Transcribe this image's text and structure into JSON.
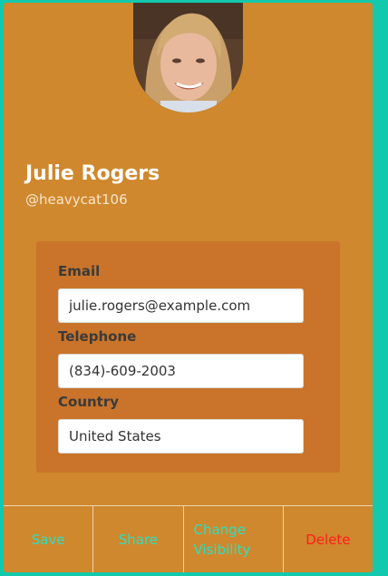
{
  "profile": {
    "name": "Julie Rogers",
    "handle": "@heavycat106"
  },
  "fields": {
    "email": {
      "label": "Email",
      "value": "julie.rogers@example.com"
    },
    "telephone": {
      "label": "Telephone",
      "value": "(834)-609-2003"
    },
    "country": {
      "label": "Country",
      "value": "United States"
    }
  },
  "actions": {
    "save": "Save",
    "share": "Share",
    "change_visibility_line1": "Change",
    "change_visibility_line2": "Visibility",
    "delete": "Delete"
  },
  "colors": {
    "background": "#12c9ad",
    "card": "#cf882d",
    "panel": "#c9742a",
    "action_text": "#27e1c5",
    "delete_text": "#ff1d1d"
  }
}
